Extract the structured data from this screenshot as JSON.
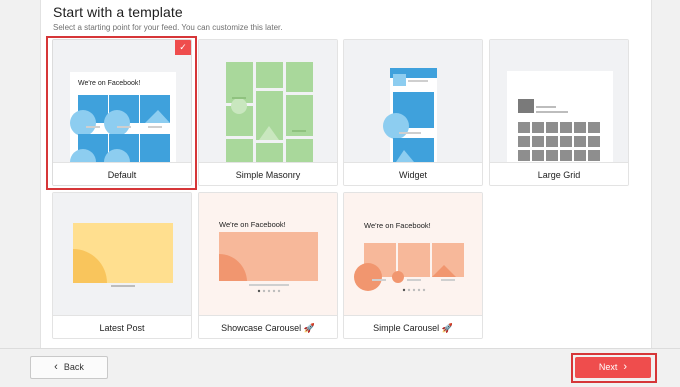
{
  "header": {
    "title": "Start with a template",
    "subtitle": "Select a starting point for your feed. You can customize this later."
  },
  "templates": [
    {
      "label": "Default",
      "selected": true,
      "preview_title": "We're on Facebook!"
    },
    {
      "label": "Simple Masonry",
      "selected": false
    },
    {
      "label": "Widget",
      "selected": false
    },
    {
      "label": "Large Grid",
      "selected": false
    },
    {
      "label": "Latest Post",
      "selected": false
    },
    {
      "label": "Showcase Carousel 🚀",
      "selected": false,
      "preview_title": "We're on Facebook!"
    },
    {
      "label": "Simple Carousel 🚀",
      "selected": false,
      "preview_title": "We're on Facebook!"
    }
  ],
  "check_icon": "✓",
  "footer": {
    "back_label": "Back",
    "back_icon": "‹",
    "next_label": "Next",
    "next_icon": "›"
  },
  "colors": {
    "accent": "#ef4d4d",
    "selected_outline": "#d63638",
    "blue_tile": "#3fa1dc",
    "green_tile": "#a9d89b",
    "orange_tile": "#f7b89a",
    "yellow_tile": "#ffdf8f"
  }
}
